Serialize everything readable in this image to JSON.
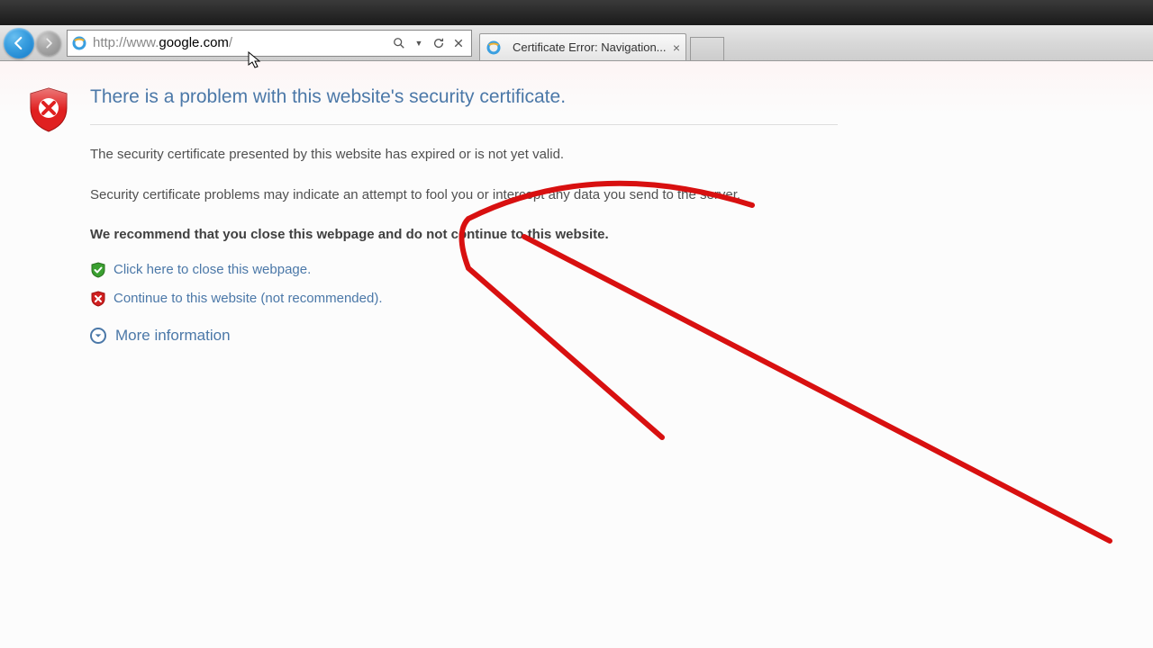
{
  "address": {
    "url_prefix": "http://www.",
    "url_host": "google.com",
    "url_suffix": "/"
  },
  "tab": {
    "title": "Certificate Error: Navigation..."
  },
  "page": {
    "heading": "There is a problem with this website's security certificate.",
    "p1": "The security certificate presented by this website has expired or is not yet valid.",
    "p2": "Security certificate problems may indicate an attempt to fool you or intercept any data you send to the server.",
    "recommend": "We recommend that you close this webpage and do not continue to this website.",
    "close_link": "Click here to close this webpage.",
    "continue_link": "Continue to this website (not recommended).",
    "more_info": "More information"
  }
}
